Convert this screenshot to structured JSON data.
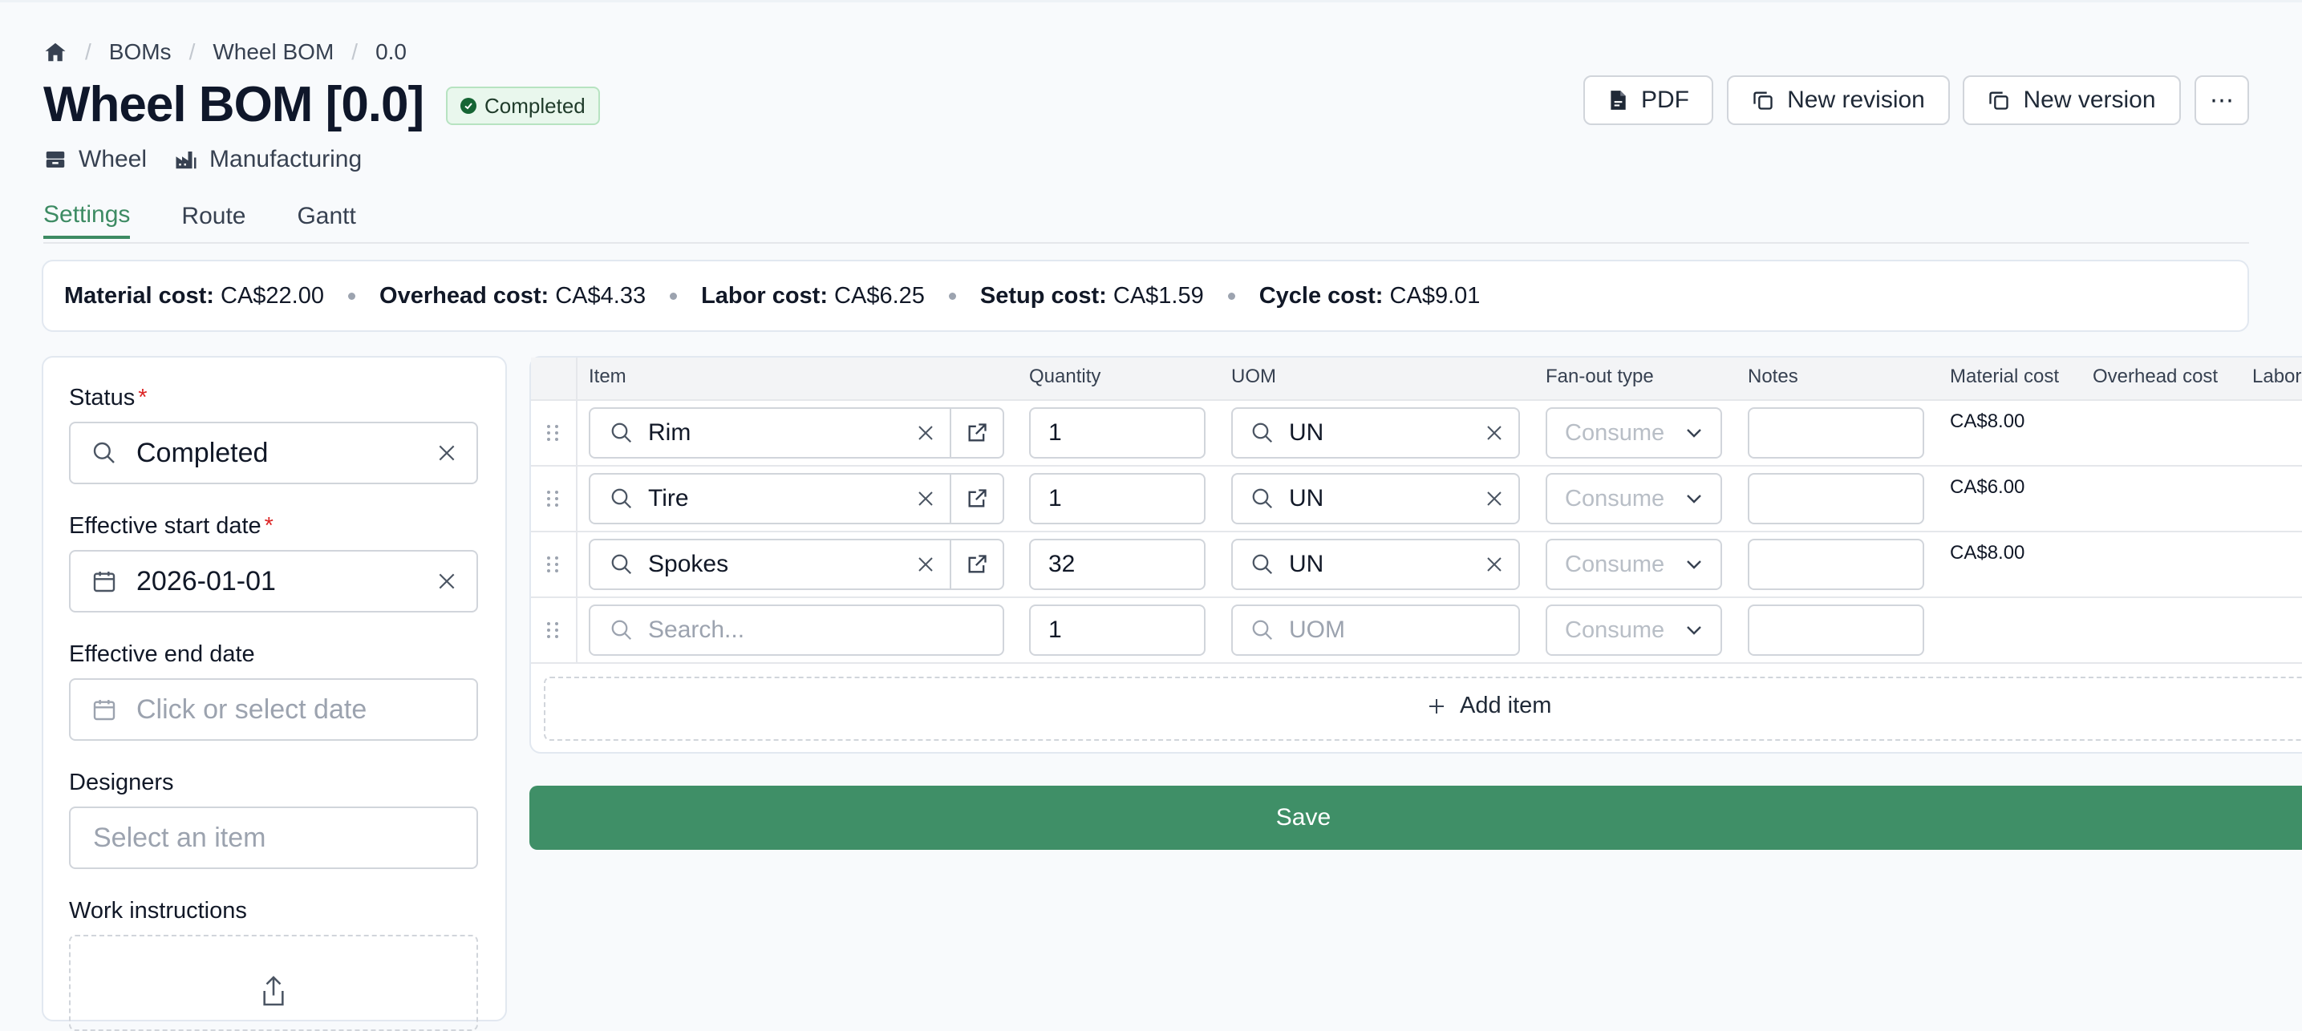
{
  "breadcrumb": {
    "items": [
      "BOMs",
      "Wheel BOM",
      "0.0"
    ]
  },
  "header": {
    "title": "Wheel BOM [0.0]",
    "status_badge": "Completed",
    "meta": {
      "item": "Wheel",
      "type": "Manufacturing"
    },
    "actions": {
      "pdf": "PDF",
      "new_revision": "New revision",
      "new_version": "New version",
      "more": "⋯"
    }
  },
  "tabs": [
    {
      "label": "Settings",
      "active": true
    },
    {
      "label": "Route",
      "active": false
    },
    {
      "label": "Gantt",
      "active": false
    }
  ],
  "costs": {
    "material": {
      "label": "Material cost:",
      "value": "CA$22.00"
    },
    "overhead": {
      "label": "Overhead cost:",
      "value": "CA$4.33"
    },
    "labor": {
      "label": "Labor cost:",
      "value": "CA$6.25"
    },
    "setup": {
      "label": "Setup cost:",
      "value": "CA$1.59"
    },
    "cycle": {
      "label": "Cycle cost:",
      "value": "CA$9.01"
    }
  },
  "form": {
    "status": {
      "label": "Status",
      "value": "Completed"
    },
    "start_date": {
      "label": "Effective start date",
      "value": "2026-01-01"
    },
    "end_date": {
      "label": "Effective end date",
      "placeholder": "Click or select date"
    },
    "designers": {
      "label": "Designers",
      "placeholder": "Select an item"
    },
    "work_instructions": {
      "label": "Work instructions"
    }
  },
  "table": {
    "columns": {
      "item": "Item",
      "quantity": "Quantity",
      "uom": "UOM",
      "fanout": "Fan-out type",
      "notes": "Notes",
      "material_cost": "Material cost",
      "overhead_cost": "Overhead cost",
      "labor": "Labor"
    },
    "rows": [
      {
        "item": "Rim",
        "quantity": "1",
        "uom": "UN",
        "fanout": "Consume",
        "notes": "",
        "material_cost": "CA$8.00"
      },
      {
        "item": "Tire",
        "quantity": "1",
        "uom": "UN",
        "fanout": "Consume",
        "notes": "",
        "material_cost": "CA$6.00"
      },
      {
        "item": "Spokes",
        "quantity": "32",
        "uom": "UN",
        "fanout": "Consume",
        "notes": "",
        "material_cost": "CA$8.00"
      }
    ],
    "new_row": {
      "item_placeholder": "Search...",
      "quantity": "1",
      "uom_placeholder": "UOM",
      "fanout": "Consume"
    },
    "add_item": "Add item"
  },
  "save_label": "Save"
}
